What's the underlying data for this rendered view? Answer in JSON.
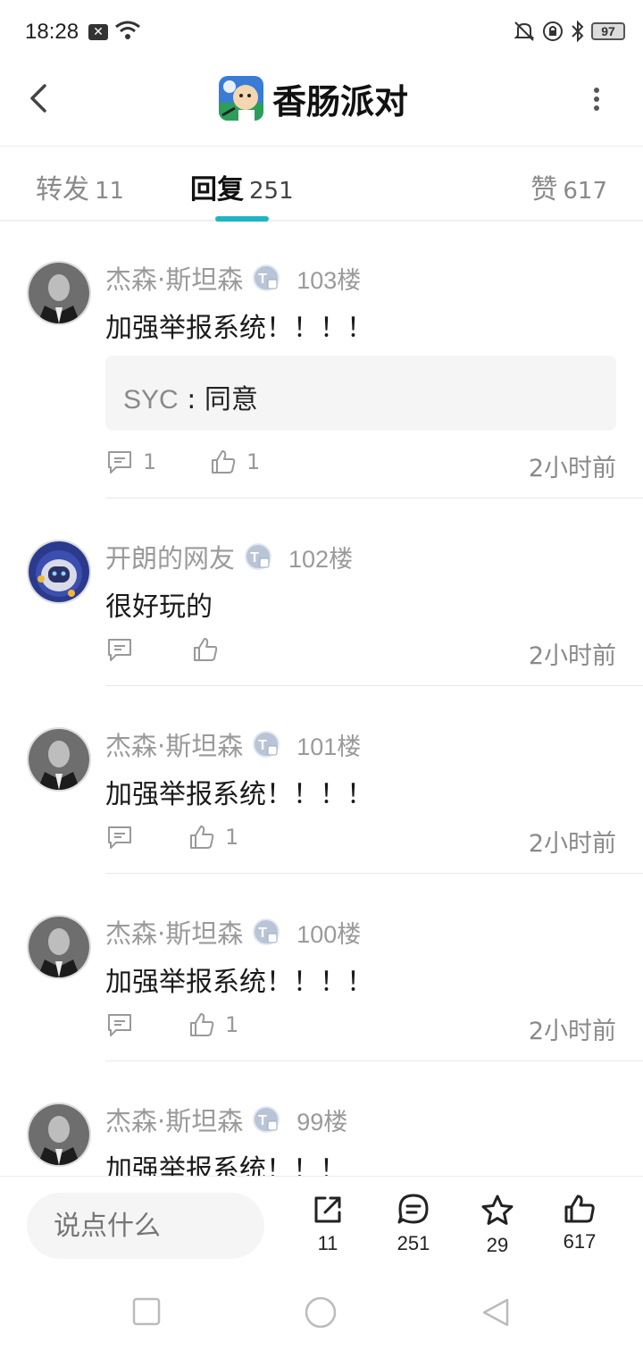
{
  "status_bar": {
    "time": "18:28",
    "battery": "97"
  },
  "app_bar": {
    "title": "香肠派对",
    "game_icon": "game-avatar-icon"
  },
  "tabs": [
    {
      "label": "转发",
      "count": "11"
    },
    {
      "label": "回复",
      "count": "251"
    },
    {
      "label": "赞",
      "count": "617"
    }
  ],
  "comments": [
    {
      "username": "杰森·斯坦森",
      "floor": "103楼",
      "text": "加强举报系统！！！！",
      "quote": {
        "name": "SYC",
        "sep": " : ",
        "text": "同意"
      },
      "reply_count": "1",
      "like_count": "1",
      "time": "2小时前"
    },
    {
      "username": "开朗的网友",
      "floor": "102楼",
      "text": "很好玩的",
      "reply_count": "",
      "like_count": "",
      "time": "2小时前"
    },
    {
      "username": "杰森·斯坦森",
      "floor": "101楼",
      "text": "加强举报系统！！！！",
      "reply_count": "",
      "like_count": "1",
      "time": "2小时前"
    },
    {
      "username": "杰森·斯坦森",
      "floor": "100楼",
      "text": "加强举报系统！！！！",
      "reply_count": "",
      "like_count": "1",
      "time": "2小时前"
    },
    {
      "username": "杰森·斯坦森",
      "floor": "99楼",
      "text": "加强举报系统！！！"
    }
  ],
  "bottom_bar": {
    "placeholder": "说点什么",
    "share_count": "11",
    "comment_count": "251",
    "star_count": "29",
    "like_count": "617"
  },
  "colors": {
    "accent": "#1fb3c5",
    "muted": "#9a9a9a"
  }
}
